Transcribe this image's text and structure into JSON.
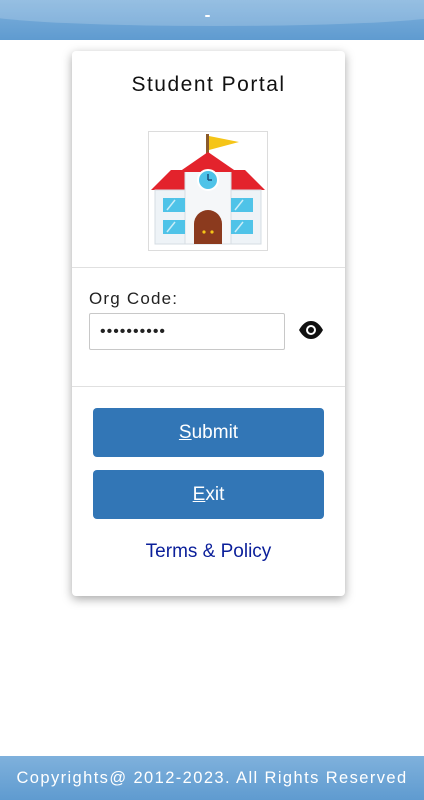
{
  "header": {
    "icon": "notch-mark"
  },
  "card": {
    "title": "Student Portal",
    "logo": {
      "icon": "school-building-icon",
      "colors": {
        "roof": "#e3232c",
        "flag": "#f5c518",
        "window": "#4fc3e8",
        "door": "#8b3a1e"
      }
    },
    "org_code": {
      "label": "Org Code:",
      "value": "••••••••••",
      "placeholder": ""
    },
    "visibility_toggle": {
      "icon": "eye-icon"
    },
    "submit": {
      "hotkey": "S",
      "rest": "ubmit"
    },
    "exit": {
      "hotkey": "E",
      "rest": "xit"
    },
    "terms_link": "Terms & Policy"
  },
  "footer": {
    "text": "Copyrights@ 2012-2023. All Rights Reserved"
  },
  "colors": {
    "accent": "#3276b6",
    "bar": "#6aa3d5",
    "link": "#0b1f9a"
  }
}
